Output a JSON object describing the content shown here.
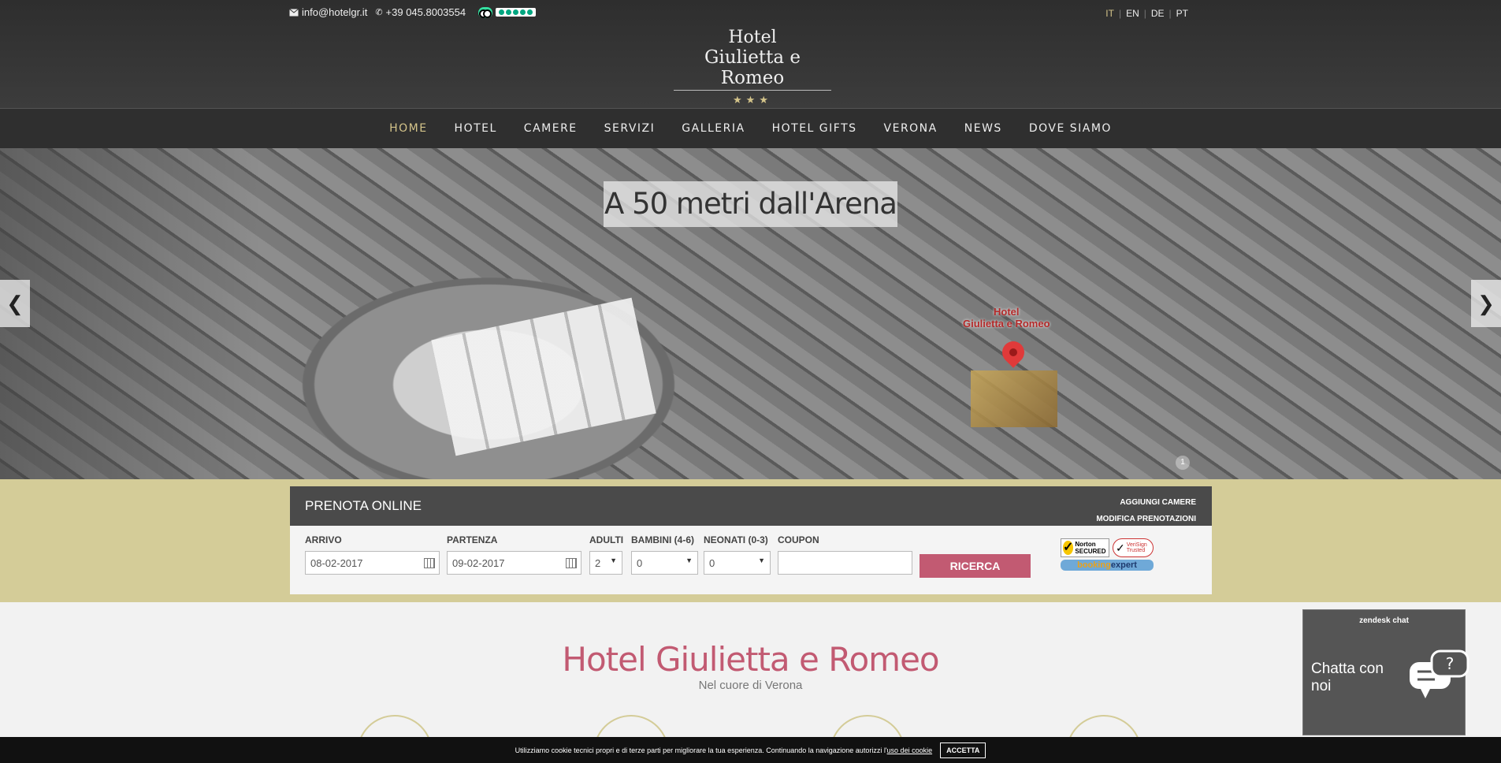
{
  "header": {
    "email": "info@hotelgr.it",
    "phone": "+39 045.8003554",
    "languages": [
      "IT",
      "EN",
      "DE",
      "PT"
    ],
    "active_language": "IT",
    "logo": {
      "line1": "Hotel",
      "line2": "Giulietta e Romeo",
      "stars": "★★★"
    }
  },
  "nav": {
    "items": [
      "HOME",
      "HOTEL",
      "CAMERE",
      "SERVIZI",
      "GALLERIA",
      "HOTEL GIFTS",
      "VERONA",
      "NEWS",
      "DOVE SIAMO"
    ],
    "active": "HOME"
  },
  "hero": {
    "caption": "A 50 metri dall'Arena",
    "pin_label_1": "Hotel",
    "pin_label_2": "Giulietta e Romeo",
    "prev": "❮",
    "next": "❯",
    "slide_number": "1"
  },
  "booking": {
    "title": "PRENOTA ONLINE",
    "link_add": "AGGIUNGI CAMERE",
    "link_modify": "MODIFICA PRENOTAZIONI",
    "arrivo_label": "ARRIVO",
    "arrivo_value": "08-02-2017",
    "partenza_label": "PARTENZA",
    "partenza_value": "09-02-2017",
    "adulti_label": "ADULTI",
    "adulti_value": "2",
    "bambini_label": "BAMBINI (4-6)",
    "bambini_value": "0",
    "neonati_label": "NEONATI (0-3)",
    "neonati_value": "0",
    "coupon_label": "COUPON",
    "coupon_value": "",
    "search_label": "RICERCA",
    "norton": "Norton SECURED",
    "verisign": "VeriSign Trusted",
    "bookingexpert_a": "booking",
    "bookingexpert_b": "expert"
  },
  "content": {
    "title": "Hotel Giulietta e Romeo",
    "subtitle": "Nel cuore di Verona"
  },
  "chat": {
    "brand": "zendesk chat",
    "text": "Chatta con noi"
  },
  "cookie": {
    "text": "Utilizziamo cookie tecnici propri e di terze parti per migliorare la tua esperienza. Continuando la navigazione autorizzi l'",
    "link": "uso dei cookie",
    "accept": "ACCETTA"
  },
  "colors": {
    "accent_gold": "#d4c48a",
    "band": "#d4cc98",
    "brand_pink": "#c25a72",
    "dark": "#3a3a3a"
  },
  "icons": [
    "envelope-icon",
    "phone-icon",
    "tripadvisor-icon",
    "calendar-icon",
    "chat-bubble-icon"
  ]
}
